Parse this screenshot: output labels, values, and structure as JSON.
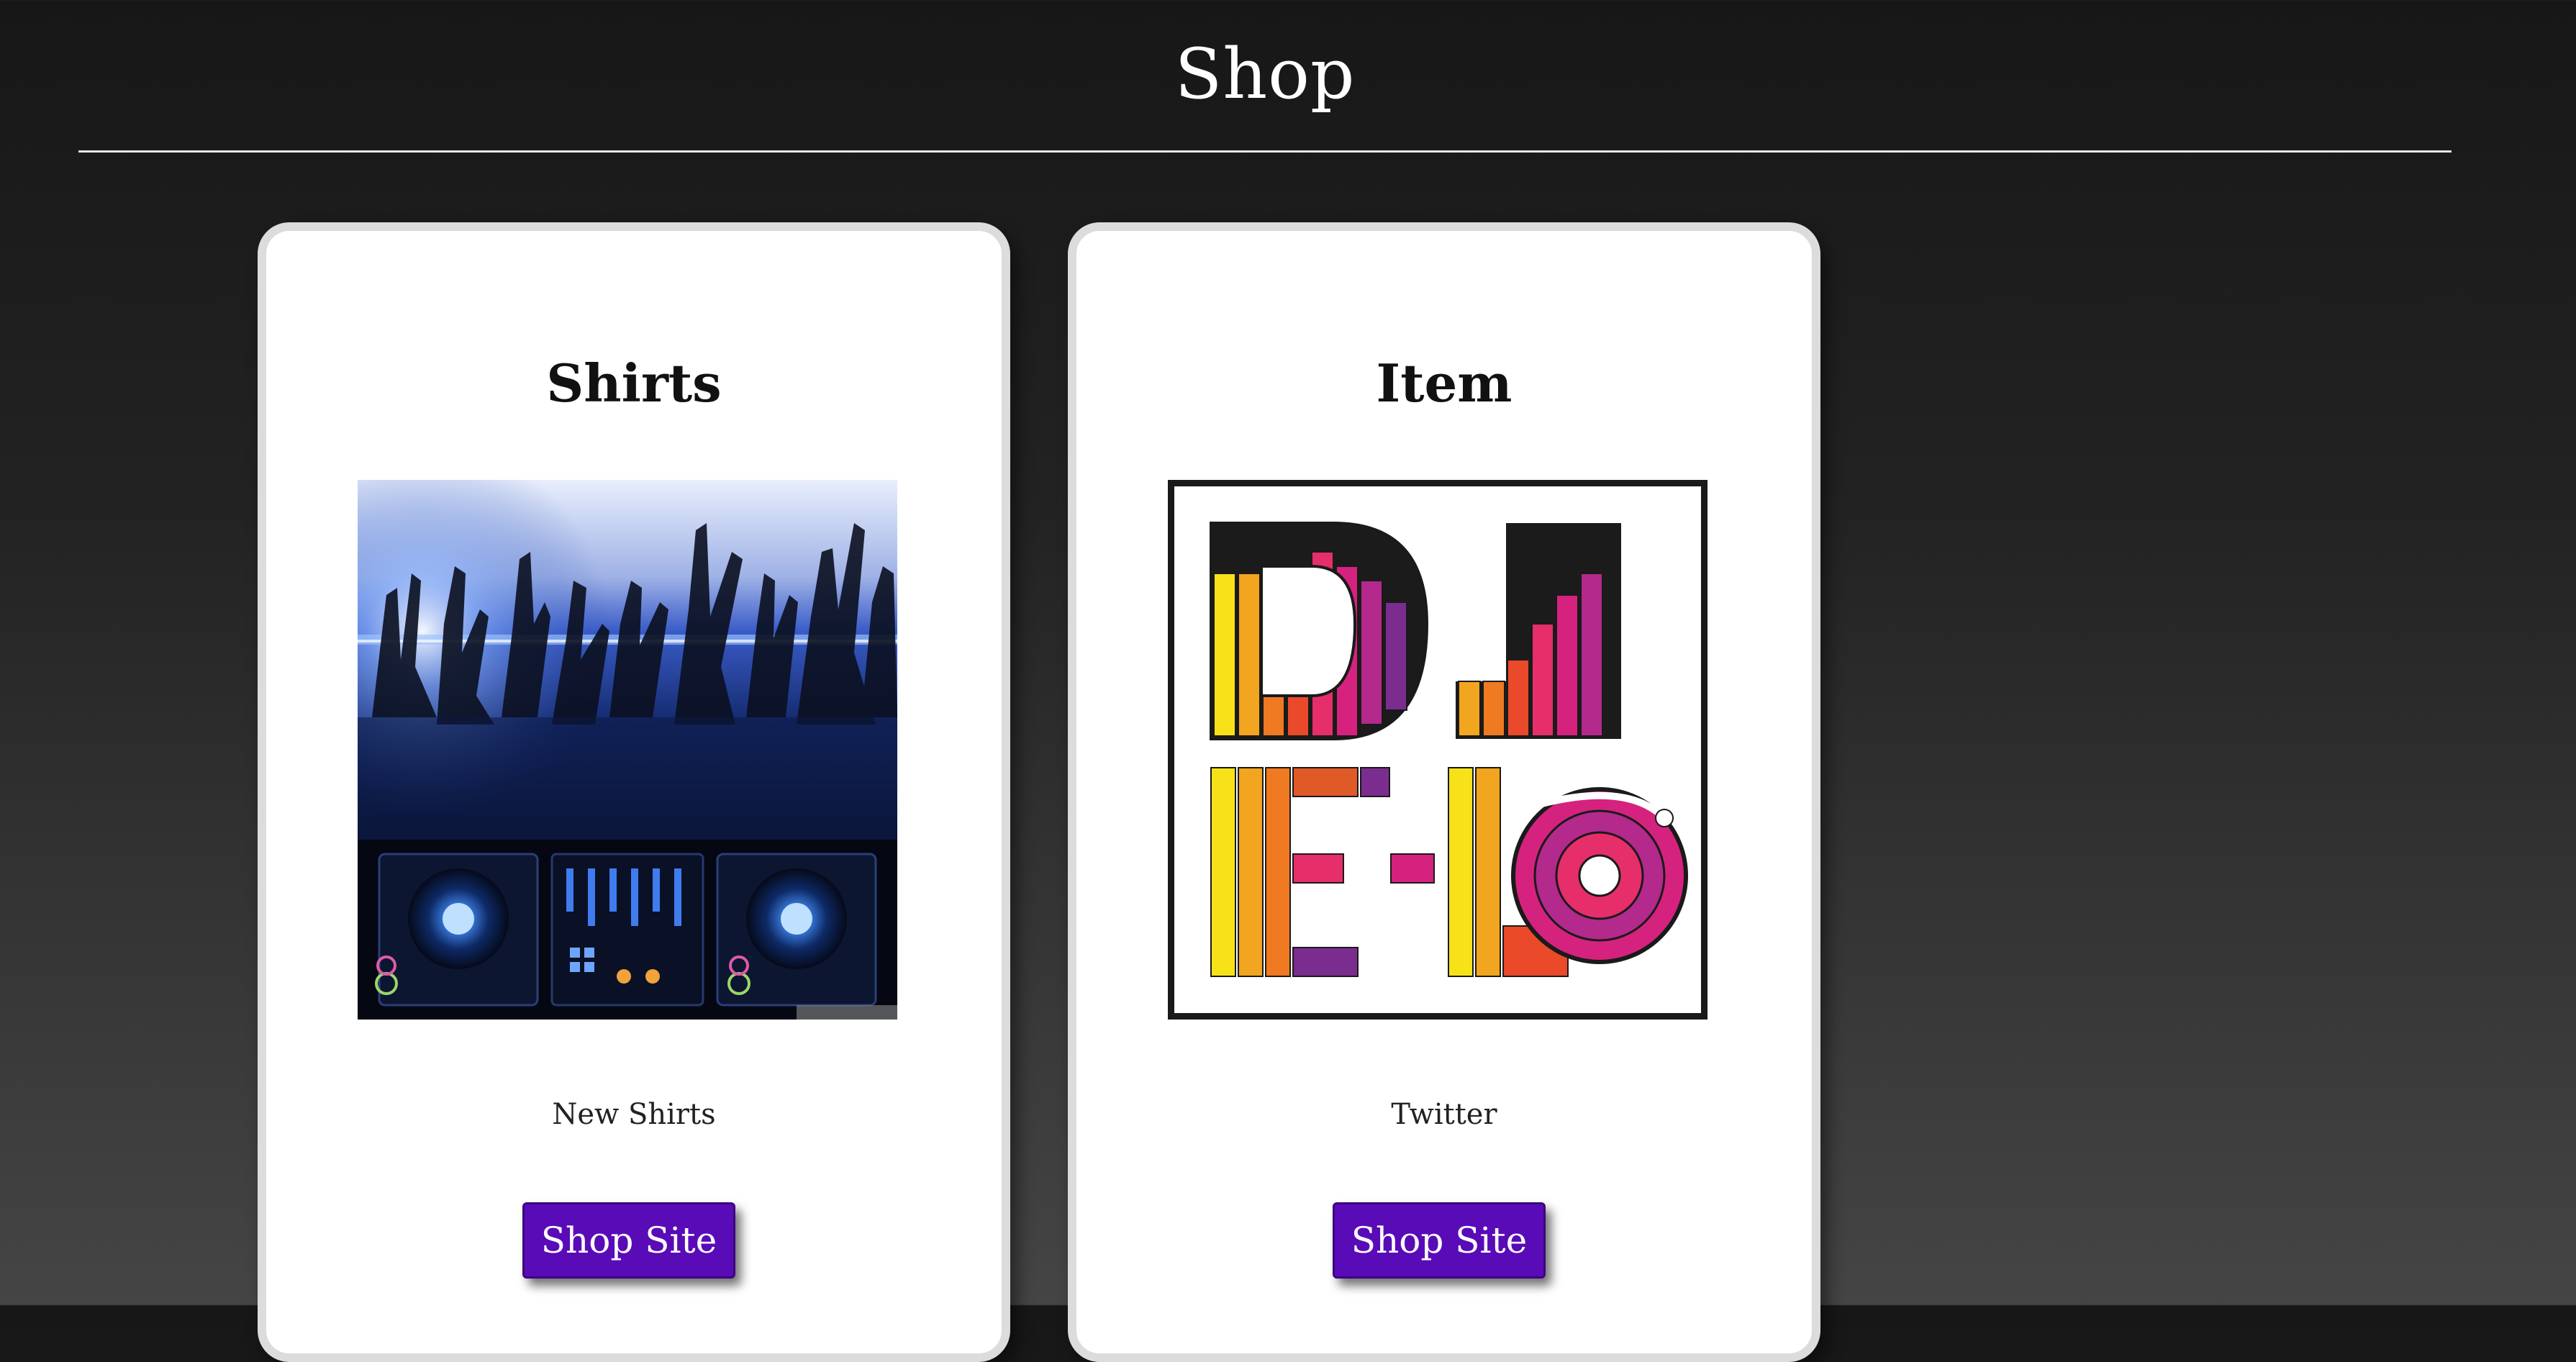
{
  "header": {
    "title": "Shop"
  },
  "cards": [
    {
      "title": "Shirts",
      "image_icon": "dj-crowd-photo",
      "caption": "New Shirts",
      "button_label": "Shop Site"
    },
    {
      "title": "Item",
      "image_icon": "dj-elo-logo",
      "caption": "Twitter",
      "button_label": "Shop Site"
    }
  ],
  "colors": {
    "button": "#5a0bb8",
    "card_background": "#ffffff",
    "card_border": "#dcdcdc",
    "page_text": "#ffffff"
  }
}
